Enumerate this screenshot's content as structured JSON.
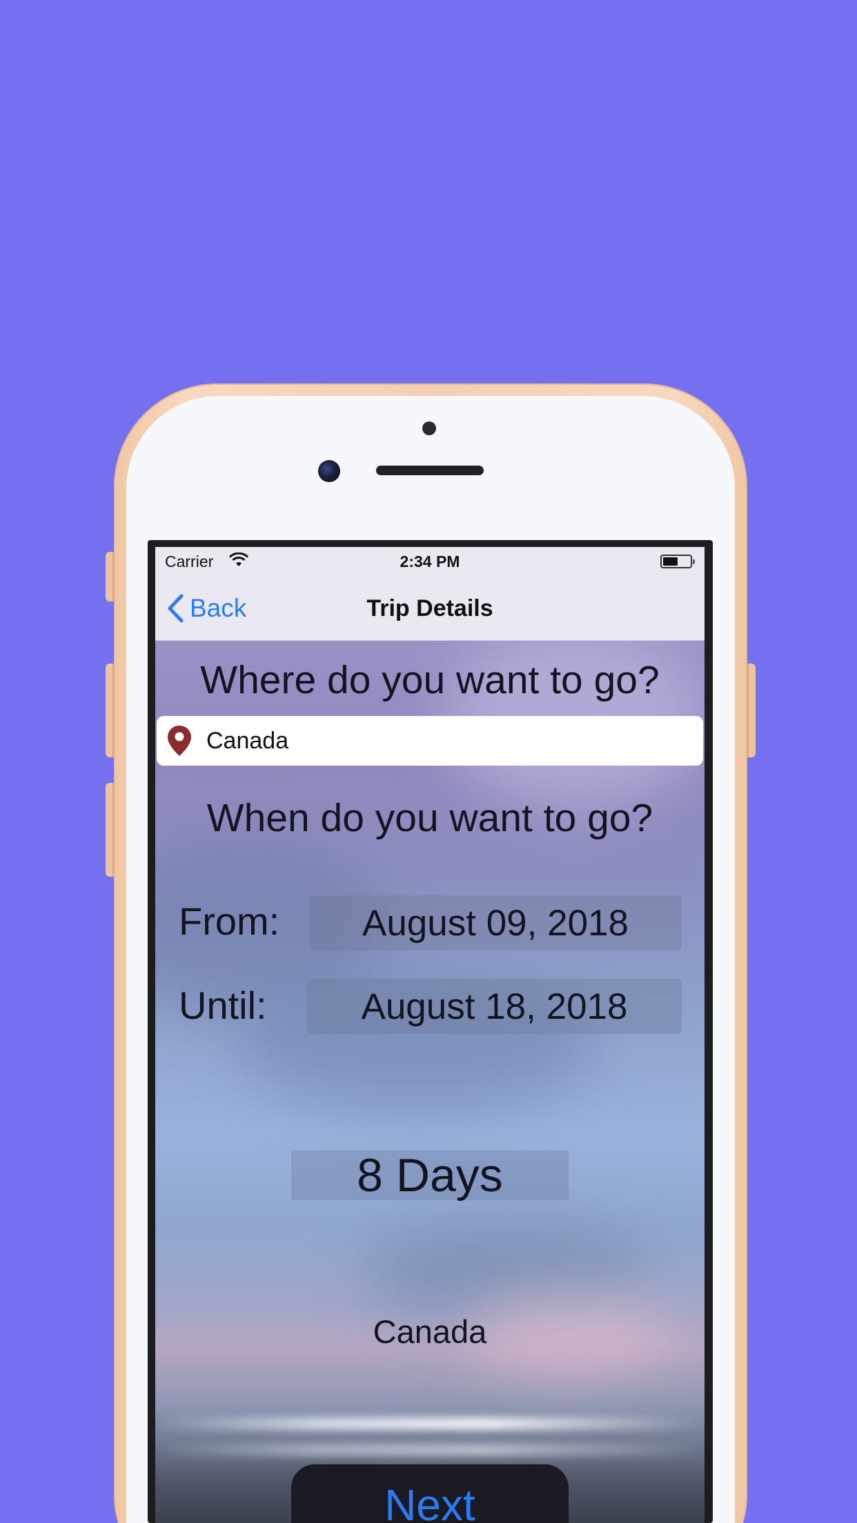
{
  "status_bar": {
    "carrier": "Carrier",
    "time": "2:34 PM",
    "wifi_icon": "wifi-icon",
    "battery_icon": "battery-icon",
    "battery_level": 0.55
  },
  "nav": {
    "back_label": "Back",
    "back_icon": "chevron-left-icon",
    "title": "Trip Details"
  },
  "destination_section": {
    "question": "Where do you want to go?",
    "search_value": "Canada",
    "pin_icon": "map-pin-icon"
  },
  "dates_section": {
    "question": "When do you want to go?",
    "from_label": "From:",
    "from_value": "August 09, 2018",
    "until_label": "Until:",
    "until_value": "August 18, 2018"
  },
  "duration": "8 Days",
  "selected_destination": "Canada",
  "next_label": "Next",
  "colors": {
    "background": "#7570f0",
    "accent": "#2a7cf6",
    "pin": "#8a2b2e",
    "phone_frame": "#f4cfb2"
  }
}
